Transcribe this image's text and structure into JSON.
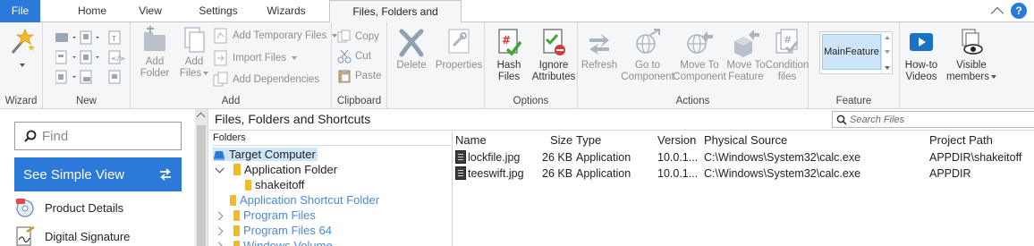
{
  "tabs": {
    "file": "File",
    "home": "Home",
    "view": "View",
    "settings": "Settings",
    "wizards": "Wizards",
    "active": "Files, Folders and Shortcuts",
    "help_glyph": "?"
  },
  "ribbon": {
    "groups": {
      "wizard": "Wizard",
      "new": "New",
      "add": "Add",
      "clipboard": "Clipboard",
      "options": "Options",
      "actions": "Actions",
      "feature": "Feature"
    },
    "add_folder": [
      "Add",
      "Folder"
    ],
    "add_files": [
      "Add",
      "Files"
    ],
    "add_temporary_files": "Add Temporary Files",
    "import_files": "Import Files",
    "add_dependencies": "Add Dependencies",
    "copy": "Copy",
    "cut": "Cut",
    "paste": "Paste",
    "delete": "Delete",
    "properties": "Properties",
    "hash_files": [
      "Hash",
      "Files"
    ],
    "ignore_attributes": [
      "Ignore",
      "Attributes"
    ],
    "refresh": "Refresh",
    "go_to_component": [
      "Go to",
      "Component"
    ],
    "move_to_component": [
      "Move To",
      "Component"
    ],
    "move_to_feature": [
      "Move To",
      "Feature"
    ],
    "condition_files": [
      "Condition",
      "files"
    ],
    "feature_selected": "MainFeature",
    "howto_videos": [
      "How-to",
      "Videos"
    ],
    "visible_members": [
      "Visible",
      "members"
    ]
  },
  "left_pane": {
    "find_placeholder": "Find",
    "simple_view": "See Simple View",
    "nav": [
      "Product Details",
      "Digital Signature"
    ]
  },
  "content": {
    "title": "Files, Folders and Shortcuts",
    "search_placeholder": "Search Files",
    "tree_header": "Folders",
    "tree": [
      {
        "label": "Target Computer",
        "selected": true
      },
      {
        "label": "Application Folder"
      },
      {
        "label": "shakeitoff"
      },
      {
        "label": "Application Shortcut Folder"
      },
      {
        "label": "Program Files"
      },
      {
        "label": "Program Files 64"
      },
      {
        "label": "Windows Volume"
      }
    ],
    "columns": [
      "Name",
      "Size",
      "Type",
      "Version",
      "Physical Source",
      "Project Path"
    ],
    "rows": [
      {
        "name": "lockfile.jpg",
        "size": "26 KB",
        "type": "Application",
        "version": "10.0.1...",
        "source": "C:\\Windows\\System32\\calc.exe",
        "path": "APPDIR\\shakeitoff"
      },
      {
        "name": "teeswift.jpg",
        "size": "26 KB",
        "type": "Application",
        "version": "10.0.1...",
        "source": "C:\\Windows\\System32\\calc.exe",
        "path": "APPDIR"
      }
    ]
  },
  "colors": {
    "accent": "#2b79d8",
    "selection": "#cde6f7",
    "disabled_text": "#8e8e8e",
    "folder": "#f2b92b"
  }
}
